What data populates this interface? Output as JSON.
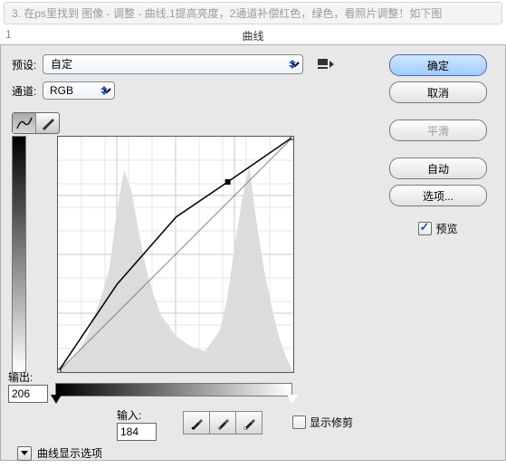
{
  "instruction": "3. 在ps里找到 图像 - 调整 - 曲线,1提高亮度，2通道补偿红色，绿色，看照片调整！如下图",
  "titlebar": {
    "one": "1",
    "title": "曲线"
  },
  "preset": {
    "label": "预设:",
    "value": "自定"
  },
  "channel": {
    "label": "通道:",
    "value": "RGB"
  },
  "output": {
    "label": "输出:",
    "value": "206"
  },
  "input": {
    "label": "输入:",
    "value": "184"
  },
  "showclip": "显示修剪",
  "disclosure": "曲线显示选项",
  "buttons": {
    "ok": "确定",
    "cancel": "取消",
    "smooth": "平滑",
    "auto": "自动",
    "options": "选项..."
  },
  "preview": "预览",
  "chart_data": {
    "type": "line",
    "xlabel": "输入",
    "ylabel": "输出",
    "xlim": [
      0,
      255
    ],
    "ylim": [
      0,
      255
    ],
    "series": [
      {
        "name": "baseline",
        "x": [
          0,
          255
        ],
        "y": [
          0,
          255
        ]
      },
      {
        "name": "curve",
        "x": [
          0,
          64,
          128,
          184,
          255
        ],
        "y": [
          0,
          95,
          168,
          206,
          255
        ]
      }
    ],
    "selected_point": {
      "x": 184,
      "y": 206
    },
    "histogram": [
      2,
      3,
      5,
      9,
      14,
      22,
      30,
      40,
      62,
      78,
      70,
      54,
      40,
      30,
      22,
      18,
      14,
      12,
      10,
      9,
      8,
      12,
      16,
      28,
      48,
      66,
      80,
      58,
      40,
      26,
      14,
      6
    ]
  }
}
